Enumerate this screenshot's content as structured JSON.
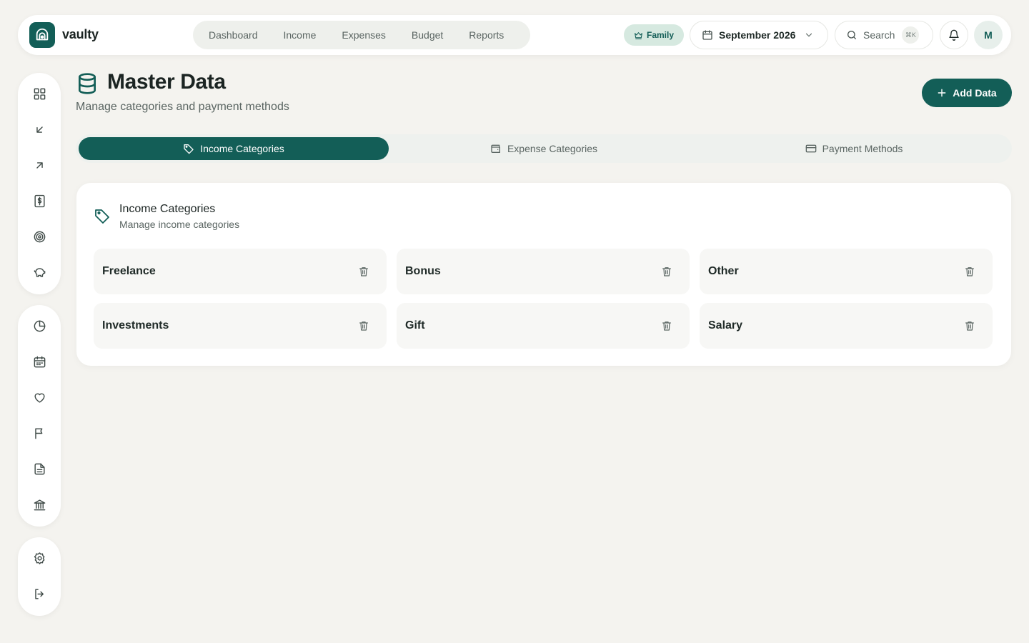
{
  "app": {
    "name": "vaulty"
  },
  "nav": {
    "items": [
      "Dashboard",
      "Income",
      "Expenses",
      "Budget",
      "Reports"
    ]
  },
  "topbar": {
    "family_badge": "Family",
    "date": "September 2026",
    "search_label": "Search",
    "search_shortcut": "⌘K",
    "avatar_initial": "M"
  },
  "header": {
    "title": "Master Data",
    "subtitle": "Manage categories and payment methods",
    "add_button": "Add Data"
  },
  "tabs": [
    {
      "label": "Income Categories",
      "active": true
    },
    {
      "label": "Expense Categories",
      "active": false
    },
    {
      "label": "Payment Methods",
      "active": false
    }
  ],
  "card": {
    "title": "Income Categories",
    "subtitle": "Manage income categories",
    "items": [
      "Freelance",
      "Bonus",
      "Other",
      "Investments",
      "Gift",
      "Salary"
    ]
  },
  "colors": {
    "accent": "#135e57",
    "background": "#f4f3ef",
    "badge": "#d6e9e0"
  }
}
